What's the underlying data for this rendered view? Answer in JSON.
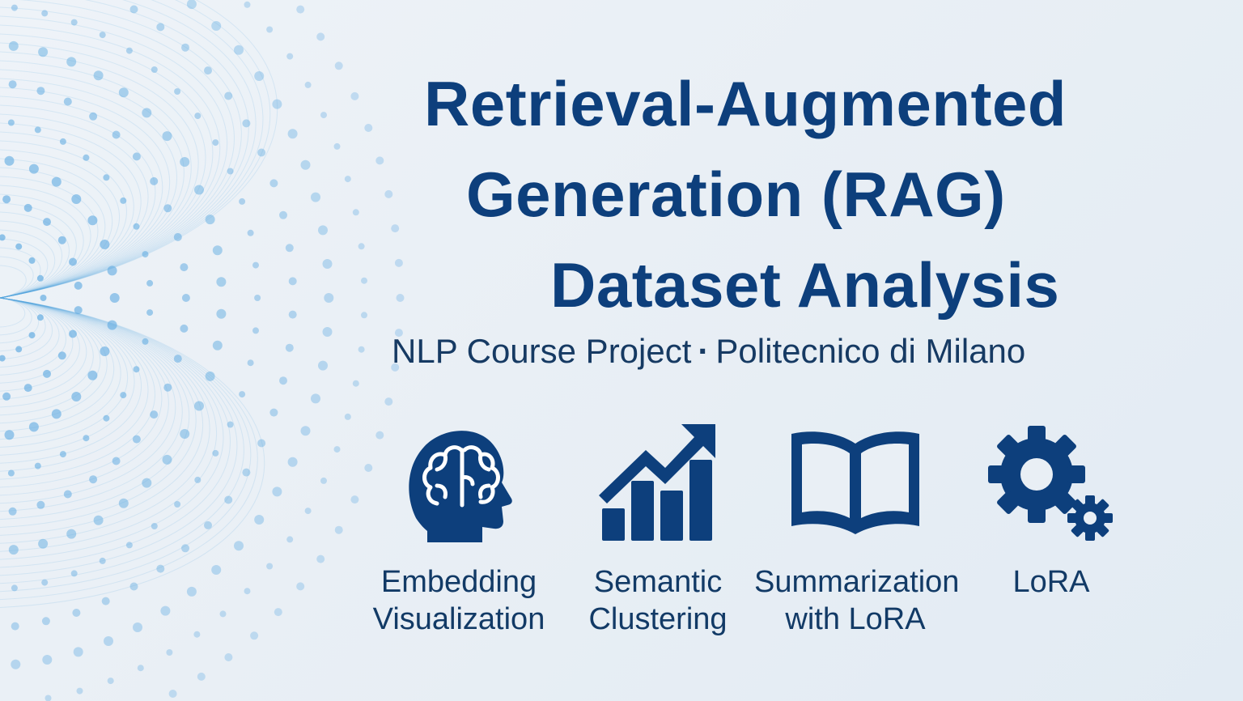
{
  "title": {
    "line1": "Retrieval-Augmented",
    "line2": "Generation (RAG)",
    "line3": "Dataset Analysis"
  },
  "subtitle": {
    "course": "NLP Course Project",
    "separator": "·",
    "institution": "Politecnico di Milano"
  },
  "features": [
    {
      "icon": "brain-head-icon",
      "label": "Embedding\nVisualization"
    },
    {
      "icon": "growth-chart-icon",
      "label": "Semantic\nClustering"
    },
    {
      "icon": "open-book-icon",
      "label": "Summarization\nwith LoRA"
    },
    {
      "icon": "gears-icon",
      "label": "LoRA"
    }
  ],
  "colors": {
    "primary": "#0d3f7c",
    "text": "#163a63",
    "decor": "#5aa7e0",
    "background": "#eaf0f6"
  }
}
